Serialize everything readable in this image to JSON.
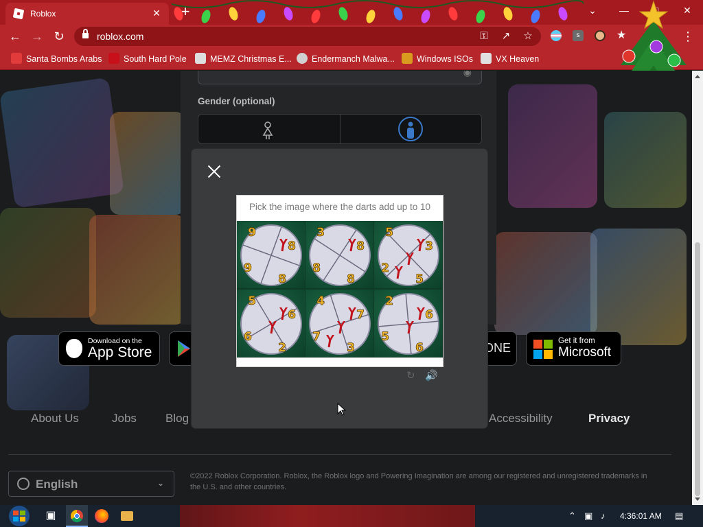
{
  "browser": {
    "tab_title": "Roblox",
    "tab_close": "✕",
    "new_tab": "+",
    "url": "roblox.com",
    "window_controls": [
      "⌄",
      "—",
      "□",
      "✕"
    ]
  },
  "bookmarks": [
    {
      "label": "Santa Bombs Arabs",
      "icon": "santa-icon",
      "color": "#e23b3b"
    },
    {
      "label": "South Hard Pole",
      "icon": "snowflake-icon",
      "color": "#c8101a"
    },
    {
      "label": "MEMZ Christmas E...",
      "icon": "memz-icon",
      "color": "#dddddd"
    },
    {
      "label": "Endermanch Malwa...",
      "icon": "skull-icon",
      "color": "#d0d0d0"
    },
    {
      "label": "Windows ISOs",
      "icon": "trophy-icon",
      "color": "#d99b1f"
    },
    {
      "label": "VX Heaven",
      "icon": "vx-icon",
      "color": "#e0e0e0"
    }
  ],
  "signup": {
    "gender_label": "Gender (optional)"
  },
  "captcha": {
    "prompt": "Pick the image where the darts add up to 10",
    "cells": [
      {
        "numbers": [
          "9",
          "8",
          "9",
          "8"
        ],
        "darts": 1
      },
      {
        "numbers": [
          "3",
          "8",
          "8",
          "8"
        ],
        "darts": 1
      },
      {
        "numbers": [
          "5",
          "3",
          "2",
          "5"
        ],
        "darts": 3
      },
      {
        "numbers": [
          "5",
          "6",
          "6",
          "2"
        ],
        "darts": 2
      },
      {
        "numbers": [
          "4",
          "7",
          "7",
          "3"
        ],
        "darts": 3
      },
      {
        "numbers": [
          "2",
          "6",
          "5",
          "6"
        ],
        "darts": 2
      }
    ],
    "refresh_icon": "↻",
    "audio_icon": "🔊"
  },
  "store_badges": {
    "apple_small": "Download on the",
    "apple_big": "App Store",
    "xbox_partial": "ONE",
    "ms_small": "Get it from",
    "ms_big": "Microsoft"
  },
  "footer": {
    "links": [
      "About Us",
      "Jobs",
      "Blog",
      "Accessibility",
      "Privacy"
    ],
    "language": "English",
    "copyright": "©2022 Roblox Corporation. Roblox, the Roblox logo and Powering Imagination are among our registered and unregistered trademarks in the U.S. and other countries."
  },
  "taskbar": {
    "time": "4:36:01 AM"
  },
  "colors": {
    "chrome_red": "#b6262b",
    "tab_strip": "#a51a1f",
    "page_bg": "#1b1c1e",
    "modal_bg": "#3a3b3d",
    "dart_number": "#f0b629",
    "dart_red": "#c2121c"
  }
}
